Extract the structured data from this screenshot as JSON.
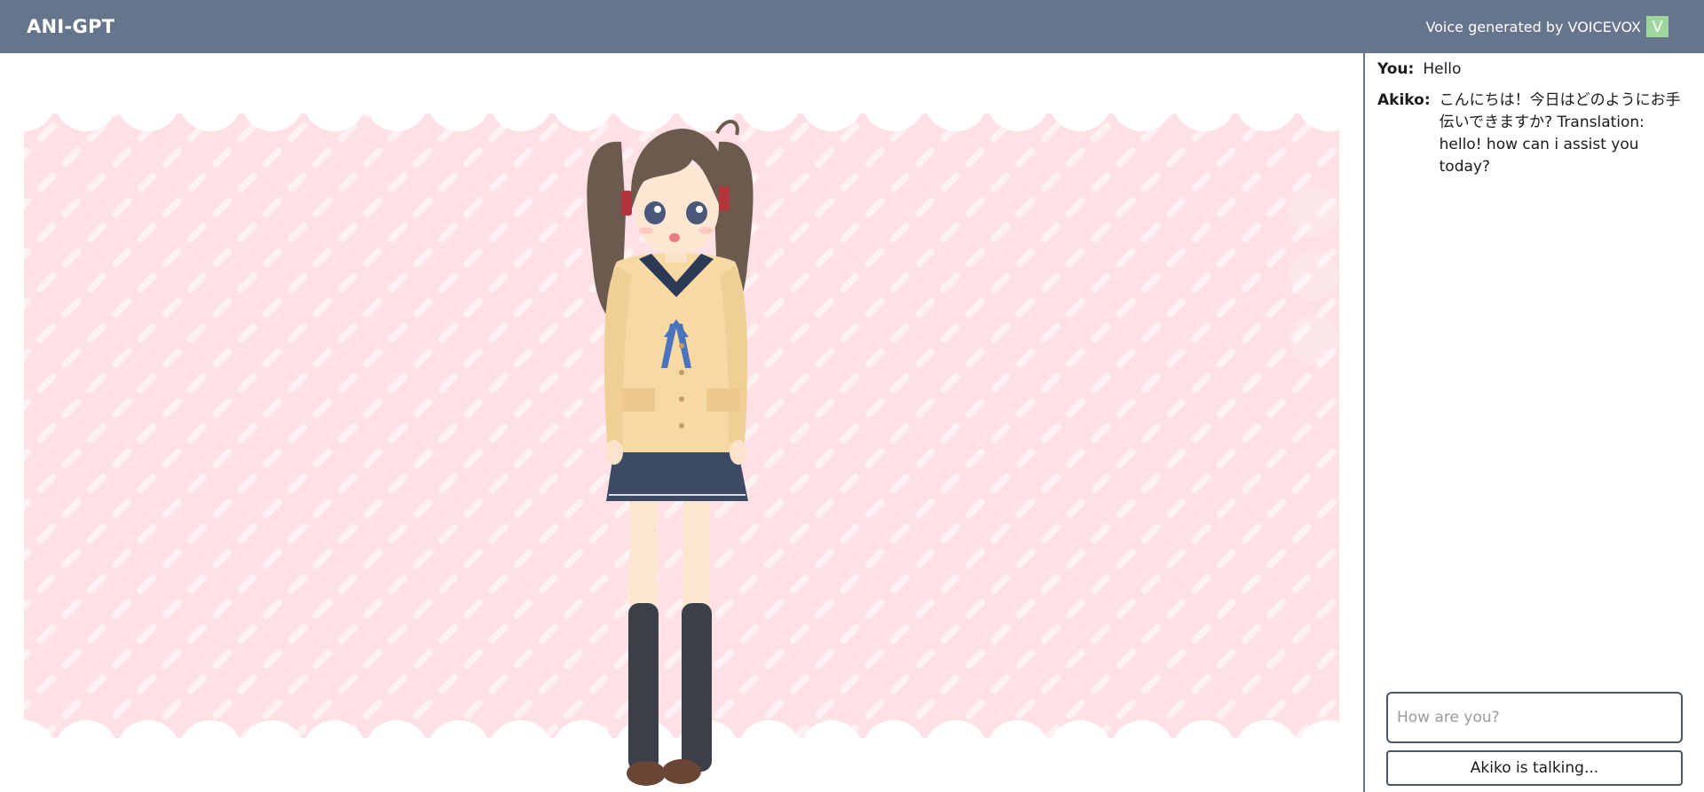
{
  "header": {
    "title": "ANI-GPT",
    "voice_credit": "Voice generated by VOICEVOX",
    "voicevox_badge": "V"
  },
  "stage": {
    "character": "anime-girl-school-uniform",
    "background_color": "#fde1e5",
    "stripe_color": "#ffffff"
  },
  "chat": {
    "messages": [
      {
        "speaker": "You:",
        "text": "Hello"
      },
      {
        "speaker": "Akiko:",
        "text": "こんにちは！今日はどのようにお手伝いできますか? Translation: hello! how can i assist you today?"
      }
    ],
    "input_placeholder": "How are you?",
    "status_button": "Akiko is talking..."
  },
  "colors": {
    "header_bg": "#65758c",
    "accent_green": "#9ed79c",
    "border": "#4a5568"
  }
}
